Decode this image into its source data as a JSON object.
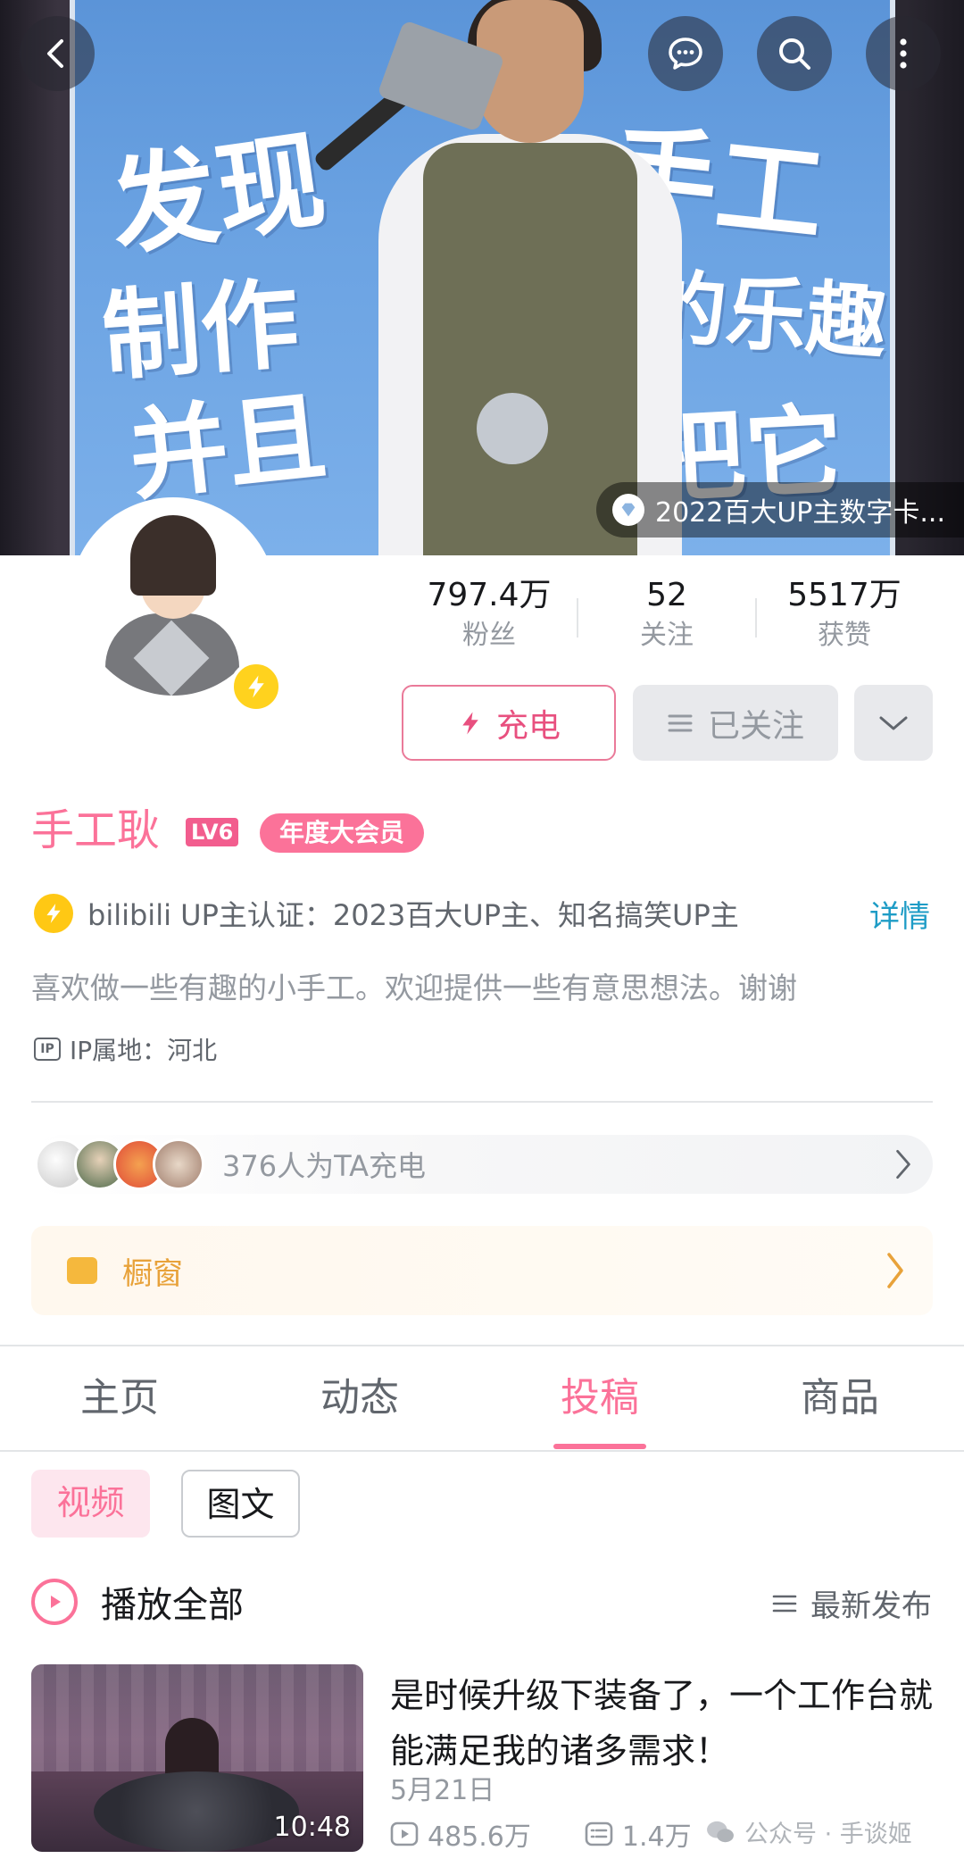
{
  "banner": {
    "text_fragments": [
      "发现",
      "制作",
      "并且",
      "手工",
      "的乐趣",
      "把它"
    ],
    "digital_card_label": "2022百大UP主数字卡..."
  },
  "topbar": {
    "icons": [
      "back-arrow-icon",
      "chat-icon",
      "search-icon",
      "more-vertical-icon"
    ]
  },
  "stats": [
    {
      "value": "797.4万",
      "label": "粉丝"
    },
    {
      "value": "52",
      "label": "关注"
    },
    {
      "value": "5517万",
      "label": "获赞"
    }
  ],
  "actions": {
    "charge_label": "充电",
    "followed_label": "已关注"
  },
  "profile": {
    "name": "手工耿",
    "level": "LV6",
    "vip_label": "年度大会员",
    "verification": "bilibili UP主认证：2023百大UP主、知名搞笑UP主",
    "details_link": "详情",
    "signature": "喜欢做一些有趣的小手工。欢迎提供一些有意思想法。谢谢",
    "ip_badge": "IP",
    "ip_location": "IP属地：河北"
  },
  "charging": {
    "text": "376人为TA充电"
  },
  "shop": {
    "label": "橱窗"
  },
  "tabs": [
    {
      "label": "主页",
      "active": false
    },
    {
      "label": "动态",
      "active": false
    },
    {
      "label": "投稿",
      "active": true
    },
    {
      "label": "商品",
      "active": false
    }
  ],
  "content_filters": [
    {
      "label": "视频",
      "active": true
    },
    {
      "label": "图文",
      "active": false
    }
  ],
  "list_header": {
    "play_all": "播放全部",
    "sort": "最新发布"
  },
  "videos": [
    {
      "title": "是时候升级下装备了，一个工作台就能满足我的诸多需求！",
      "date": "5月21日",
      "duration": "10:48",
      "views": "485.6万",
      "comments": "1.4万"
    }
  ],
  "watermark": "公众号 · 手谈姬",
  "colors": {
    "brand_pink": "#fb7299",
    "link_blue": "#1e9cc6",
    "shop_orange": "#e8a23a",
    "bolt_yellow": "#ffd21e"
  }
}
